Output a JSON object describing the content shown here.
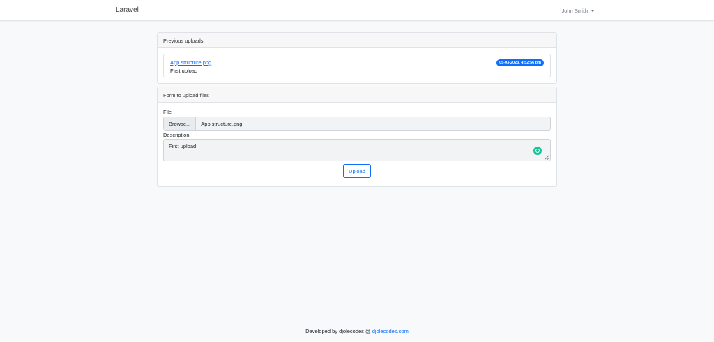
{
  "navbar": {
    "brand": "Laravel",
    "user_name": "John Smith"
  },
  "uploads_card": {
    "header": "Previous uploads",
    "items": [
      {
        "file_name": "App structure.png",
        "description": "First upload",
        "timestamp": "05-03-2023, 4:52:56 pm"
      }
    ]
  },
  "form_card": {
    "header": "Form to upload files",
    "file_label": "File",
    "browse_label": "Browse...",
    "file_value": "App structure.png",
    "description_label": "Description",
    "description_value": "First upload",
    "submit_label": "Upload"
  },
  "footer": {
    "text": "Developed by djolecodes @",
    "link": "djolecodes.com"
  },
  "colors": {
    "primary": "#0d6efd",
    "background": "#f8f9fa",
    "grammar_icon": "#15c39a"
  }
}
